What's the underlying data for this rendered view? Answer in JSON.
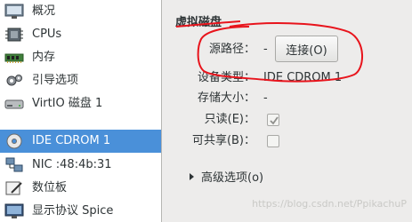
{
  "sidebar": {
    "items": [
      {
        "label": "概况",
        "icon": "overview-monitor-icon"
      },
      {
        "label": "CPUs",
        "icon": "cpu-chip-icon"
      },
      {
        "label": "内存",
        "icon": "memory-icon"
      },
      {
        "label": "引导选项",
        "icon": "boot-gear-icon"
      },
      {
        "label": "VirtIO 磁盘 1",
        "icon": "hard-disk-icon"
      },
      {
        "label": "IDE CDROM 1",
        "icon": "cdrom-icon"
      },
      {
        "label": "NIC :48:4b:31",
        "icon": "network-icon"
      },
      {
        "label": "数位板",
        "icon": "tablet-icon"
      },
      {
        "label": "显示协议 Spice",
        "icon": "display-icon"
      }
    ],
    "selected": "IDE CDROM 1"
  },
  "details": {
    "title": "虚拟磁盘",
    "source_path": {
      "label": "源路径：",
      "value": "-"
    },
    "connect_button": "连接(O)",
    "device_type": {
      "label": "设备类型：",
      "value": "IDE CDROM 1"
    },
    "storage_size": {
      "label": "存储大小：",
      "value": "-"
    },
    "readonly": {
      "label": "只读(E)：",
      "checked": true
    },
    "shareable": {
      "label": "可共享(B)：",
      "checked": false
    },
    "advanced": "高级选项(o)"
  },
  "watermark": "https://blog.csdn.net/PpikachuP",
  "colors": {
    "selection": "#4a90d9",
    "annotation": "#e8141c"
  }
}
